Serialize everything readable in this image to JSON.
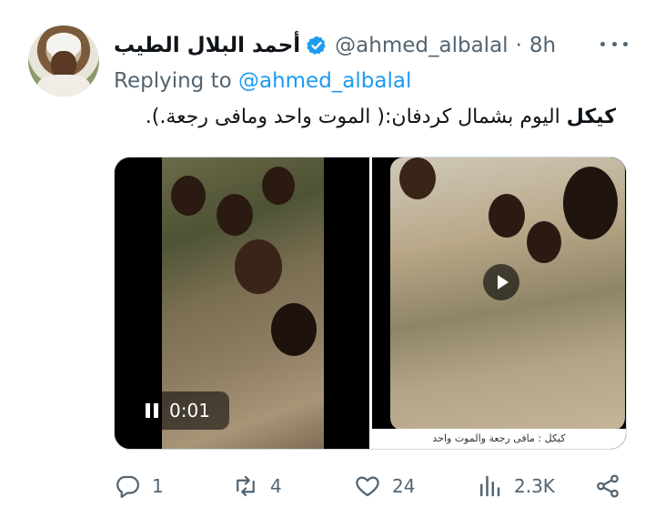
{
  "tweet": {
    "author_name": "أحمد البلال الطيب",
    "handle": "@ahmed_albalal",
    "separator": "·",
    "time": "8h",
    "replying_prefix": "Replying to",
    "replying_handle": "@ahmed_albalal",
    "text_bold": "كيكل",
    "text_rest": "اليوم بشمال كردفان:( الموت واحد ومافى رجعة.).",
    "media": {
      "video1_time": "0:01",
      "video2_caption": "كيكل : مافى رجعة والموت واحد"
    },
    "actions": {
      "replies": "1",
      "retweets": "4",
      "likes": "24",
      "views": "2.3K"
    }
  },
  "colors": {
    "accent": "#1d9bf0",
    "secondary_text": "#536471",
    "primary_text": "#0f1419"
  },
  "icons": [
    "verified-badge-icon",
    "more-icon",
    "pause-icon",
    "play-icon",
    "reply-icon",
    "retweet-icon",
    "like-icon",
    "views-icon",
    "share-icon"
  ]
}
